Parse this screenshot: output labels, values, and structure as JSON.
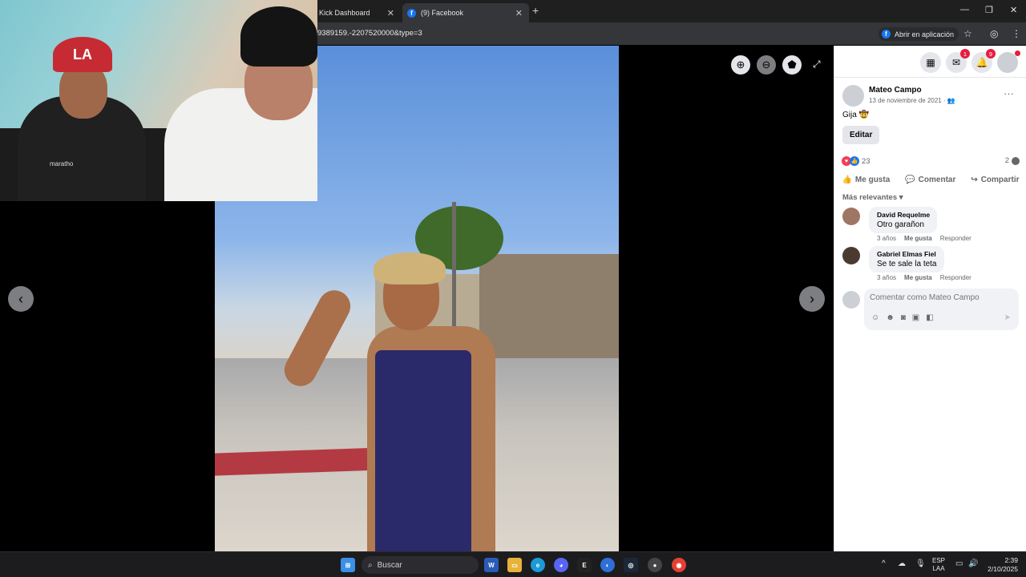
{
  "browser": {
    "tabs": [
      {
        "label": "Kick Dashboard",
        "active": false
      },
      {
        "label": "(9) Facebook",
        "active": true
      }
    ],
    "url": "9389159.-2207520000&type=3",
    "open_app_label": "Abrir en aplicación"
  },
  "webcam": {
    "cap_logo": "LA",
    "shirt_brand": "maratho"
  },
  "post": {
    "author": "Mateo Campo",
    "date": "13 de noviembre de 2021",
    "text": "Gija 🤠",
    "edit_label": "Editar",
    "reaction_count": "23",
    "comment_count": "2",
    "actions": {
      "like": "Me gusta",
      "comment": "Comentar",
      "share": "Compartir"
    },
    "sort_label": "Más relevantes"
  },
  "notifications": {
    "messenger": "1",
    "bell": "9"
  },
  "comments": [
    {
      "author": "David Requelme",
      "text": "Otro garañon",
      "time": "3 años",
      "like": "Me gusta",
      "reply": "Responder"
    },
    {
      "author": "Gabriel Elmas Fiel",
      "text": "Se te sale la teta",
      "time": "3 años",
      "like": "Me gusta",
      "reply": "Responder"
    }
  ],
  "composer": {
    "placeholder": "Comentar como Mateo Campo"
  },
  "taskbar": {
    "search_label": "Buscar",
    "lang_top": "ESP",
    "lang_bottom": "LAA",
    "time": "2:39",
    "date": "2/10/2025"
  },
  "colors": {
    "fb_blue": "#1877f2",
    "badge_red": "#e41e3f"
  }
}
